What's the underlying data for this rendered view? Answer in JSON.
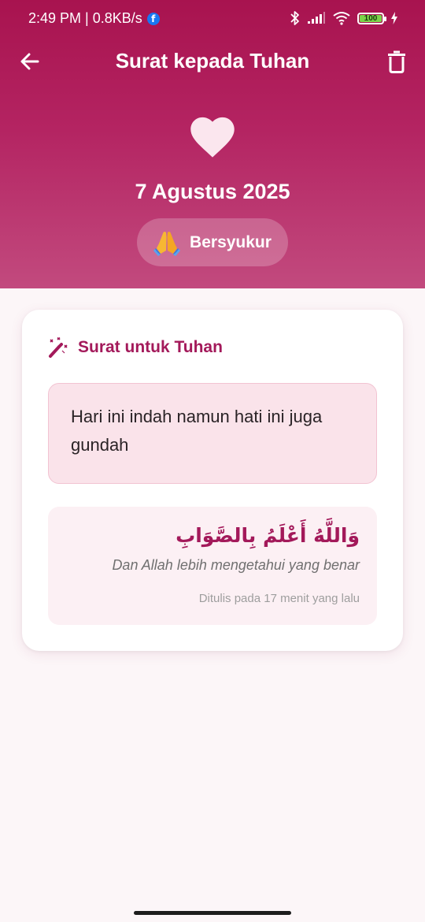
{
  "status_bar": {
    "time_speed": "2:49 PM | 0.8KB/s",
    "notification_icon": "facebook-icon",
    "battery_level": "100",
    "icons": [
      "bluetooth-icon",
      "signal-icon",
      "wifi-icon",
      "battery-icon",
      "charging-icon"
    ]
  },
  "app_bar": {
    "title": "Surat kepada Tuhan",
    "back_icon": "arrow-left-icon",
    "delete_icon": "trash-icon"
  },
  "header": {
    "icon": "heart-icon",
    "date": "7 Agustus 2025",
    "mood": {
      "emoji": "folded-hands-icon",
      "label": "Bersyukur"
    }
  },
  "card": {
    "icon": "magic-wand-icon",
    "title": "Surat untuk Tuhan",
    "letter_text": "Hari ini indah namun hati ini juga gundah",
    "closing": {
      "arabic": "وَاللَّهُ أَعْلَمُ بِالصَّوَابِ",
      "translation": "Dan Allah lebih mengetahui yang benar",
      "written_time": "Ditulis pada 17 menit yang lalu"
    }
  },
  "colors": {
    "header_top": "#a8134f",
    "header_bottom": "#c24a7e",
    "accent": "#a3195a",
    "letter_bg": "#fae3ea",
    "page_bg": "#fcf6f8"
  }
}
